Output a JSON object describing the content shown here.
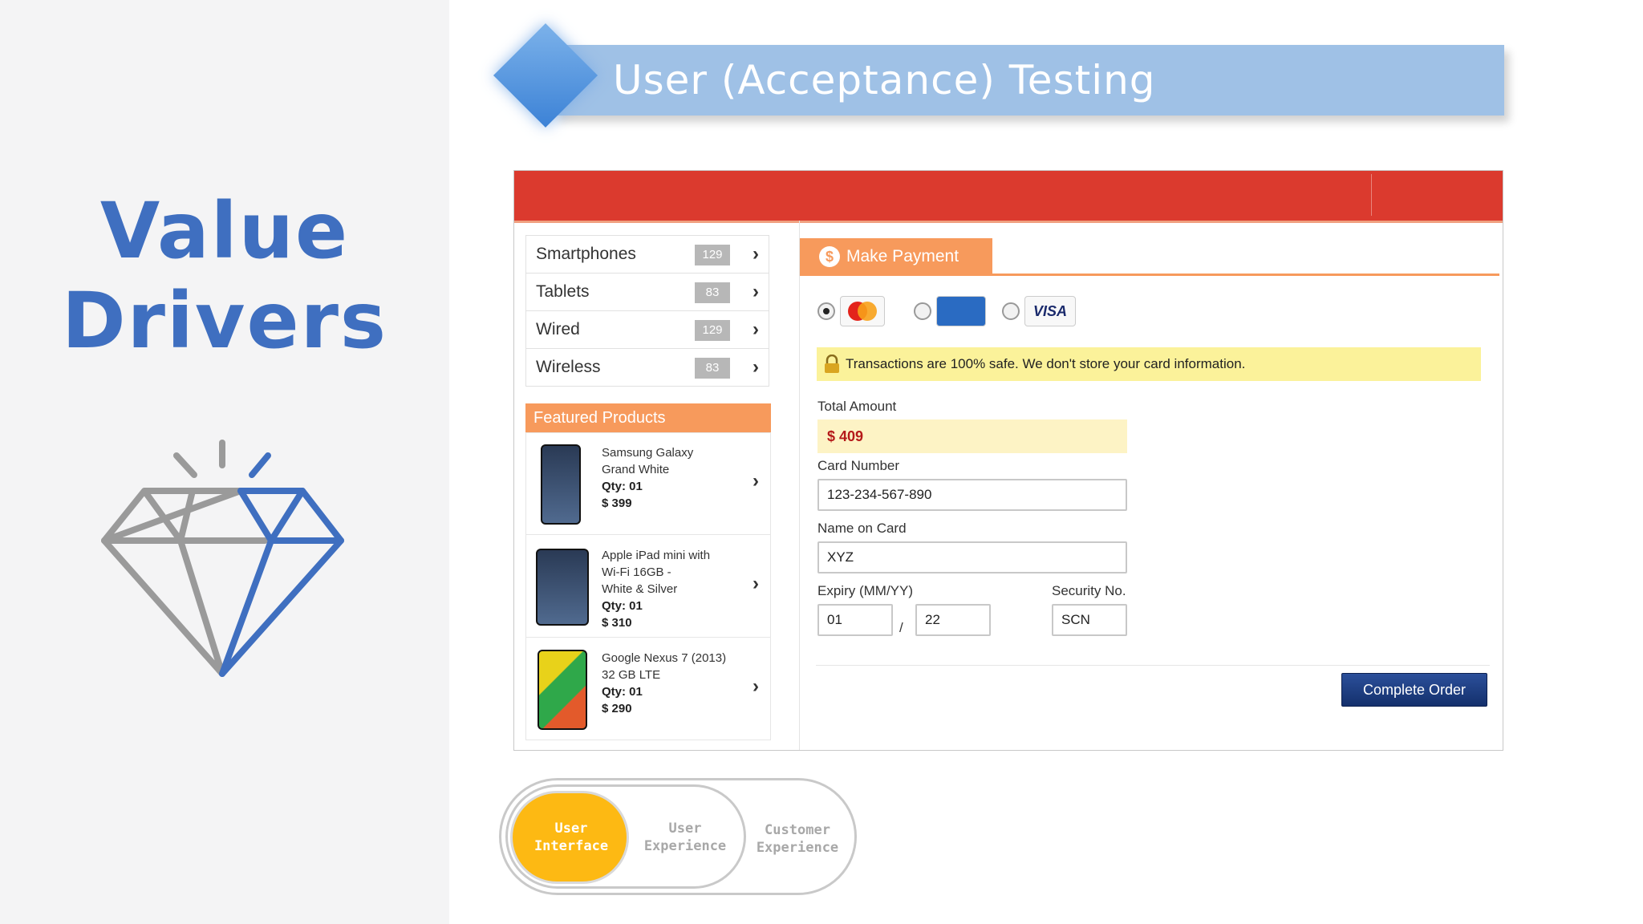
{
  "slide": {
    "section_title_line1": "Value",
    "section_title_line2": "Drivers",
    "banner_title": "User (Acceptance) Testing"
  },
  "categories": [
    {
      "label": "Smartphones",
      "count": "129"
    },
    {
      "label": "Tablets",
      "count": "83"
    },
    {
      "label": "Wired",
      "count": "129"
    },
    {
      "label": "Wireless",
      "count": "83"
    }
  ],
  "featured": {
    "header": "Featured Products",
    "items": [
      {
        "name_line1": "Samsung Galaxy",
        "name_line2": "Grand White",
        "name_line3": "",
        "qty": "Qty: 01",
        "price": "$ 399"
      },
      {
        "name_line1": "Apple iPad mini with",
        "name_line2": "Wi-Fi 16GB -",
        "name_line3": "White & Silver",
        "qty": "Qty: 01",
        "price": "$ 310"
      },
      {
        "name_line1": "Google Nexus 7 (2013)",
        "name_line2": "32 GB LTE",
        "name_line3": "",
        "qty": "Qty: 01",
        "price": "$ 290"
      }
    ]
  },
  "payment": {
    "tab_label": "Make Payment",
    "card_types": [
      "MasterCard",
      "AMERICAN EXPRESS",
      "VISA"
    ],
    "selected_card": "MasterCard",
    "notice": "Transactions are 100% safe. We don't store your card information.",
    "total_label": "Total Amount",
    "total_value": "$ 409",
    "card_number_label": "Card Number",
    "card_number_value": "123-234-567-890",
    "name_label": "Name on Card",
    "name_value": "XYZ",
    "expiry_label": "Expiry (MM/YY)",
    "expiry_month": "01",
    "expiry_sep": "/",
    "expiry_year": "22",
    "security_label": "Security No.",
    "security_value": "SCN",
    "complete_button": "Complete Order"
  },
  "toggle": {
    "opt1_line1": "User",
    "opt1_line2": "Interface",
    "opt2_line1": "User",
    "opt2_line2": "Experience",
    "opt3_line1": "Customer",
    "opt3_line2": "Experience",
    "active": "User Interface"
  },
  "colors": {
    "accent_blue": "#3f6fc0",
    "banner_blue": "#9fc1e6",
    "header_red": "#db3a2e",
    "orange": "#f79a5c",
    "notice_yellow": "#fbf29a",
    "toggle_yellow": "#fdb913"
  }
}
